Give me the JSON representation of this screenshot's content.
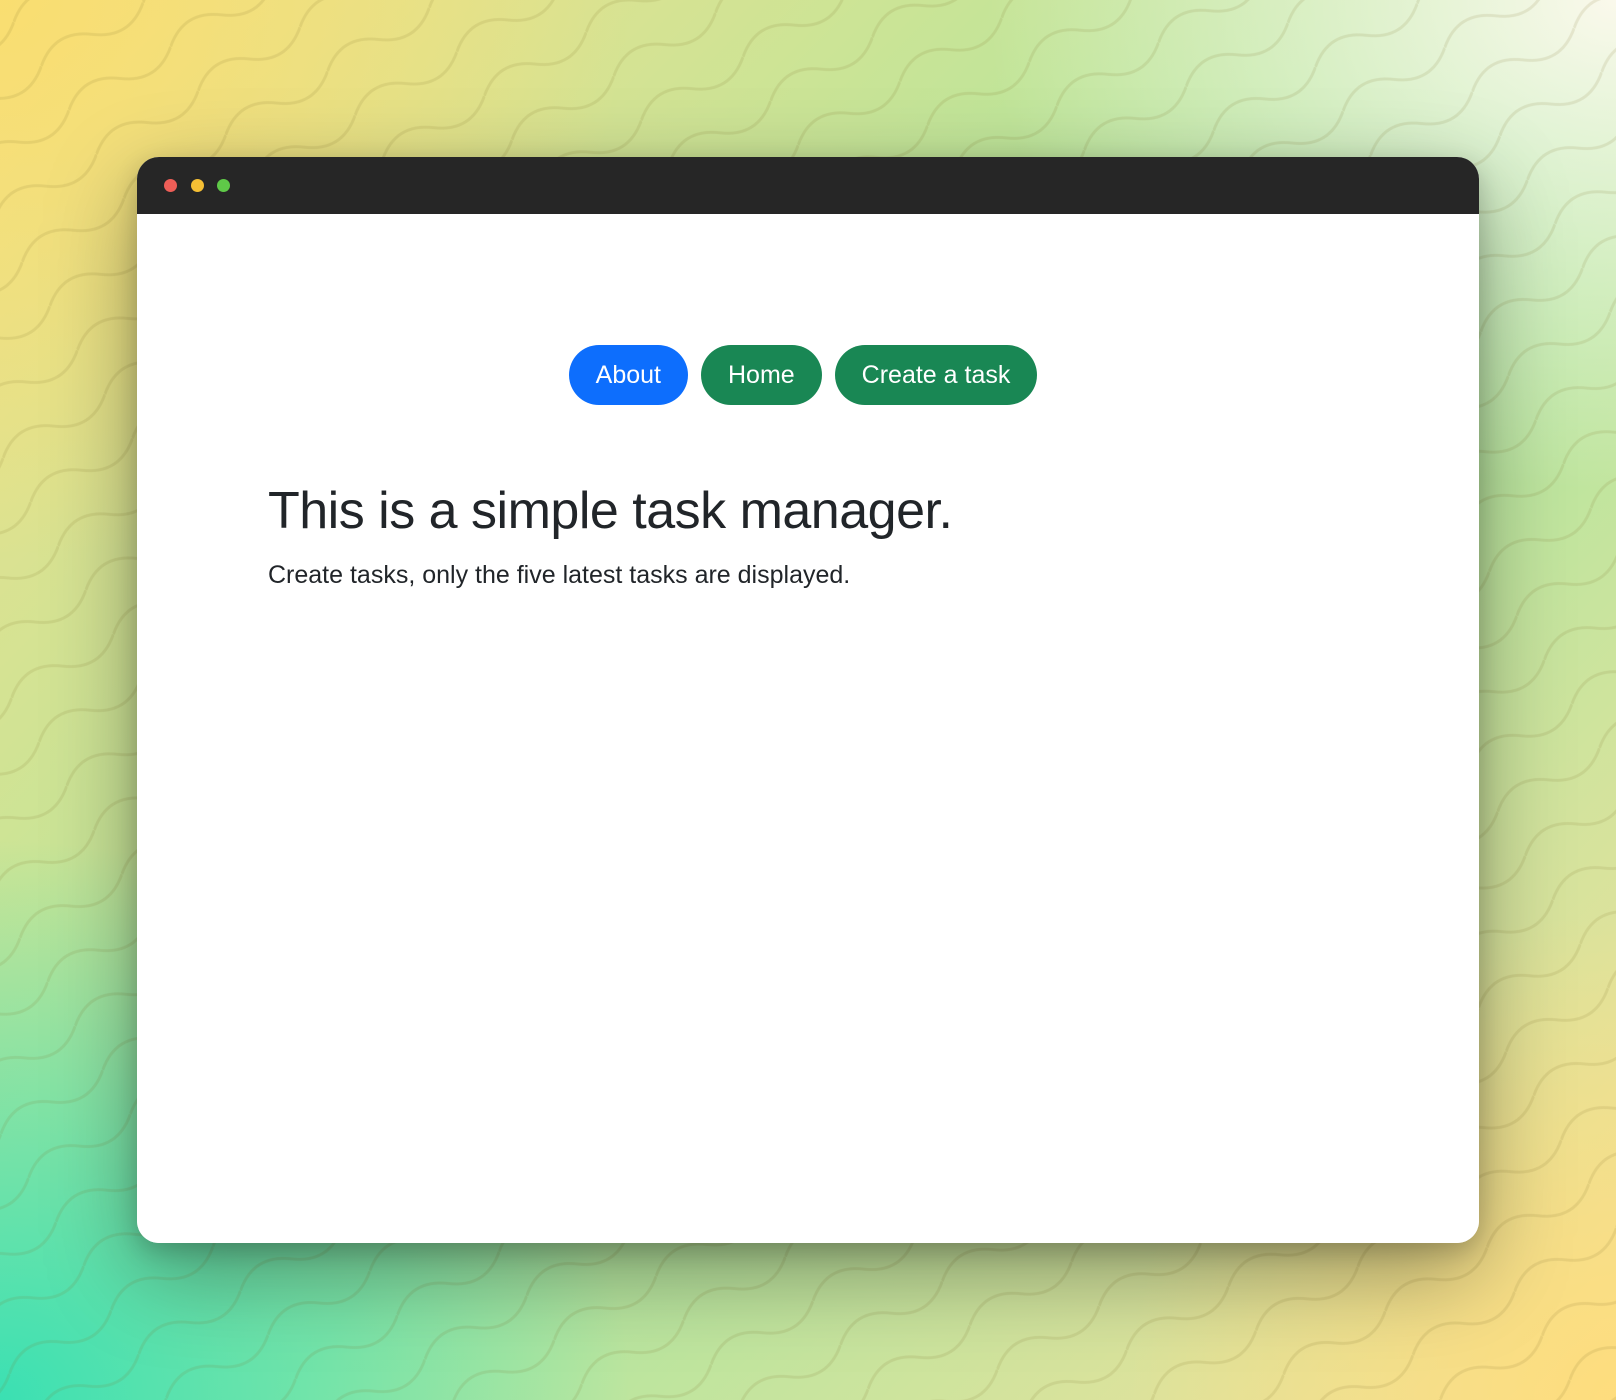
{
  "window": {
    "controls": [
      "close",
      "minimize",
      "zoom"
    ]
  },
  "nav": {
    "items": [
      {
        "label": "About",
        "style": "primary",
        "color": "#0d6efd"
      },
      {
        "label": "Home",
        "style": "success",
        "color": "#198754"
      },
      {
        "label": "Create a task",
        "style": "success",
        "color": "#198754"
      }
    ]
  },
  "main": {
    "heading": "This is a simple task manager.",
    "description": "Create tasks, only the five latest tasks are displayed."
  },
  "colors": {
    "titlebar": "#262626",
    "text": "#212529",
    "close": "#ee5e57",
    "minimize": "#f5bf34",
    "zoom": "#5fc948"
  }
}
